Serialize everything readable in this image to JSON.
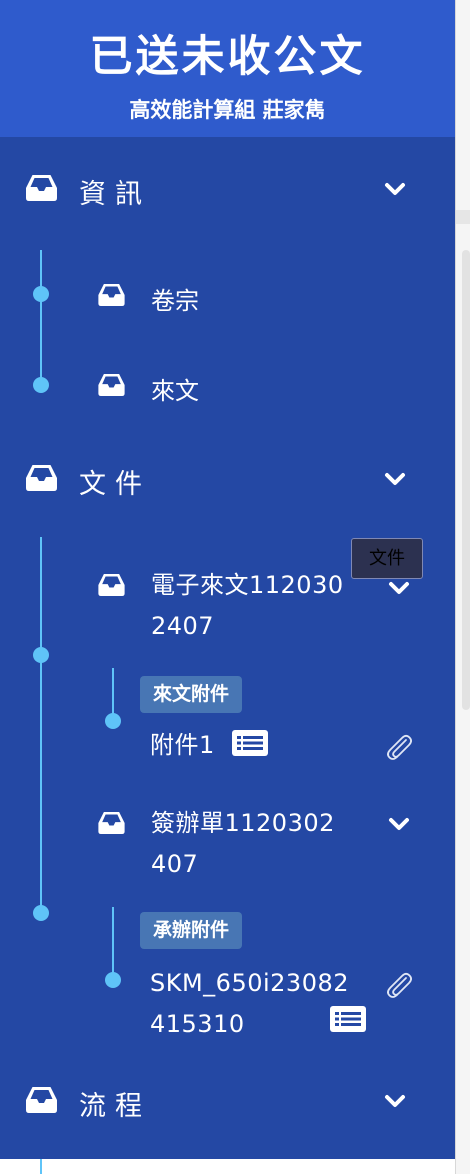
{
  "header": {
    "title": "已送未收公文",
    "subtitle": "高效能計算組 莊家雋"
  },
  "groups": {
    "info": {
      "label": "資訊",
      "items": [
        "卷宗",
        "來文"
      ]
    },
    "docs": {
      "label": "文件",
      "tooltip": "文件",
      "docs": [
        {
          "title_line1": "電子來文112030",
          "title_line2": "2407",
          "tag": "來文附件",
          "file_line1": "附件1"
        },
        {
          "title_line1": "簽辦單1120302",
          "title_line2": "407",
          "tag": "承辦附件",
          "file_line1": "SKM_650i23082",
          "file_line2": "415310"
        }
      ]
    },
    "flow": {
      "label": "流程"
    }
  },
  "colors": {
    "header_bg": "#2f5bcc",
    "sidebar_bg": "#2448a4",
    "connector": "#5fc4f8",
    "tag_bg": "#4876b4",
    "tooltip_bg": "#2c3150"
  },
  "icons": [
    "inbox-tray-icon",
    "chevron-down-icon",
    "list-icon",
    "paperclip-icon"
  ]
}
